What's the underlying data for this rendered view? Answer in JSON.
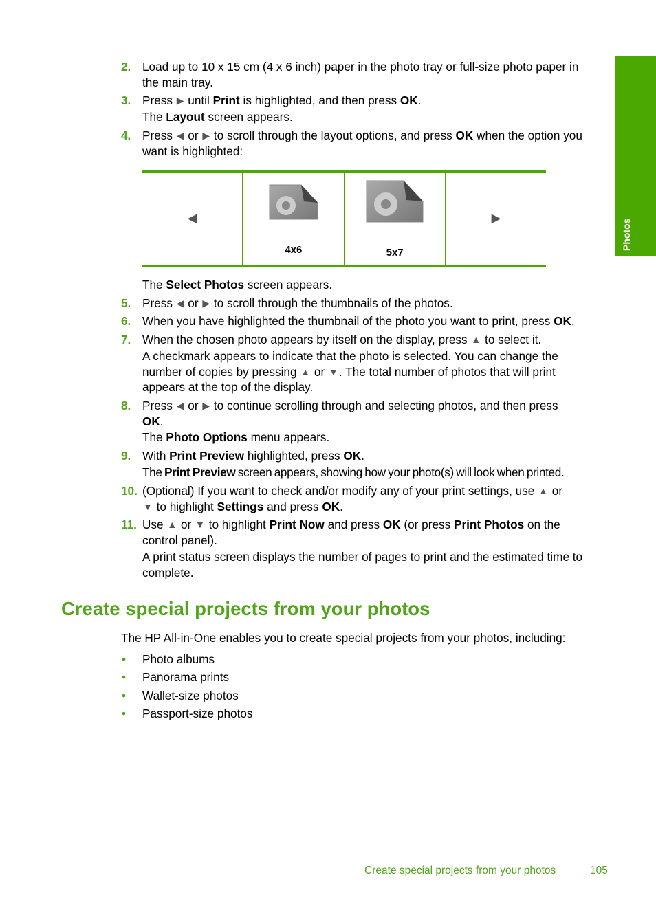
{
  "side_tab": {
    "label": "Photos"
  },
  "colors": {
    "accent": "#4aa800",
    "step_number": "#52a51a",
    "arrow_icon": "#555555"
  },
  "steps": [
    {
      "number": "2.",
      "segments": [
        [
          "t",
          "Load up to 10 x 15 cm (4 x 6 inch) paper in the photo tray or full-size photo paper in"
        ],
        [
          "br"
        ],
        [
          "t",
          "the main tray."
        ]
      ]
    },
    {
      "number": "3.",
      "segments": [
        [
          "t",
          "Press "
        ],
        [
          "i",
          "right-arrow"
        ],
        [
          "t",
          " until "
        ],
        [
          "b",
          "Print"
        ],
        [
          "t",
          " is highlighted, and then press "
        ],
        [
          "b",
          "OK"
        ],
        [
          "t",
          "."
        ]
      ]
    },
    {
      "number": "",
      "segments": [
        [
          "t",
          "The "
        ],
        [
          "b",
          "Layout"
        ],
        [
          "t",
          " screen appears."
        ]
      ]
    },
    {
      "number": "4.",
      "segments": [
        [
          "t",
          "Press "
        ],
        [
          "i",
          "left-arrow"
        ],
        [
          "t",
          " or "
        ],
        [
          "i",
          "right-arrow"
        ],
        [
          "t",
          " to scroll through the layout options, and press "
        ],
        [
          "b",
          "OK"
        ],
        [
          "t",
          " when the option you"
        ],
        [
          "br"
        ],
        [
          "t",
          "want is highlighted:"
        ]
      ]
    },
    {
      "number": "",
      "segments": [
        [
          "t",
          "The "
        ],
        [
          "b",
          "Select Photos"
        ],
        [
          "t",
          " screen appears."
        ]
      ]
    },
    {
      "number": "5.",
      "segments": [
        [
          "t",
          "Press "
        ],
        [
          "i",
          "left-arrow"
        ],
        [
          "t",
          " or "
        ],
        [
          "i",
          "right-arrow"
        ],
        [
          "t",
          " to scroll through the thumbnails of the photos."
        ]
      ]
    },
    {
      "number": "6.",
      "segments": [
        [
          "t",
          "When you have highlighted the thumbnail of the photo you want to print, press "
        ],
        [
          "b",
          "OK"
        ],
        [
          "t",
          "."
        ]
      ]
    },
    {
      "number": "7.",
      "segments": [
        [
          "t",
          "When the chosen photo appears by itself on the display, press "
        ],
        [
          "i",
          "up-arrow"
        ],
        [
          "t",
          " to select it."
        ]
      ]
    },
    {
      "number": "",
      "segments": [
        [
          "t",
          "A checkmark appears to indicate that the photo is selected. You can change the"
        ],
        [
          "br"
        ],
        [
          "t",
          "number of copies by pressing "
        ],
        [
          "i",
          "up-arrow"
        ],
        [
          "t",
          " or "
        ],
        [
          "i",
          "down-arrow"
        ],
        [
          "t",
          ". The total number of photos that will print"
        ],
        [
          "br"
        ],
        [
          "t",
          "appears at the top of the display."
        ]
      ]
    },
    {
      "number": "8.",
      "segments": [
        [
          "t",
          "Press "
        ],
        [
          "i",
          "left-arrow"
        ],
        [
          "t",
          " or "
        ],
        [
          "i",
          "right-arrow"
        ],
        [
          "t",
          " to continue scrolling through and selecting photos, and then press"
        ],
        [
          "br"
        ],
        [
          "b",
          "OK"
        ],
        [
          "t",
          "."
        ]
      ]
    },
    {
      "number": "",
      "segments": [
        [
          "t",
          "The "
        ],
        [
          "b",
          "Photo Options"
        ],
        [
          "t",
          " menu appears."
        ]
      ]
    },
    {
      "number": "9.",
      "segments": [
        [
          "t",
          "With "
        ],
        [
          "b",
          "Print Preview"
        ],
        [
          "t",
          " highlighted, press "
        ],
        [
          "b",
          "OK"
        ],
        [
          "t",
          "."
        ]
      ]
    },
    {
      "number": "",
      "condensed": true,
      "segments": [
        [
          "t",
          "The "
        ],
        [
          "b",
          "Print Preview"
        ],
        [
          "t",
          " screen appears, showing how your photo(s) will look when printed."
        ]
      ]
    },
    {
      "number": "10.",
      "segments": [
        [
          "t",
          "(Optional) If you want to check and/or modify any of your print settings, use "
        ],
        [
          "i",
          "up-arrow"
        ],
        [
          "t",
          " or"
        ],
        [
          "br"
        ],
        [
          "i",
          "down-arrow"
        ],
        [
          "t",
          " to highlight "
        ],
        [
          "b",
          "Settings"
        ],
        [
          "t",
          " and press "
        ],
        [
          "b",
          "OK"
        ],
        [
          "t",
          "."
        ]
      ]
    },
    {
      "number": "11.",
      "segments": [
        [
          "t",
          "Use "
        ],
        [
          "i",
          "up-arrow"
        ],
        [
          "t",
          " or "
        ],
        [
          "i",
          "down-arrow"
        ],
        [
          "t",
          " to highlight "
        ],
        [
          "b",
          "Print Now"
        ],
        [
          "t",
          " and press "
        ],
        [
          "b",
          "OK"
        ],
        [
          "t",
          " (or press "
        ],
        [
          "b",
          "Print Photos"
        ],
        [
          "t",
          " on the"
        ],
        [
          "br"
        ],
        [
          "t",
          "control panel)."
        ]
      ]
    },
    {
      "number": "",
      "segments": [
        [
          "t",
          "A print status screen displays the number of pages to print and the estimated time to"
        ],
        [
          "br"
        ],
        [
          "t",
          "complete."
        ]
      ]
    }
  ],
  "layout_table": {
    "options": [
      {
        "label": "4x6"
      },
      {
        "label": "5x7"
      }
    ],
    "left_icon": "left-arrow",
    "right_icon": "right-arrow"
  },
  "section": {
    "heading": "Create special projects from your photos",
    "intro": "The HP All-in-One enables you to create special projects from your photos, including:",
    "bullets": [
      "Photo albums",
      "Panorama prints",
      "Wallet-size photos",
      "Passport-size photos"
    ]
  },
  "footer": {
    "title": "Create special projects from your photos",
    "page_number": "105"
  }
}
